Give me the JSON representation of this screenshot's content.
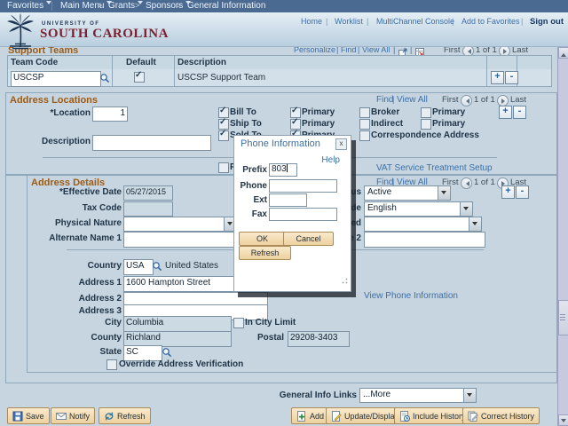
{
  "breadcrumb": {
    "favorites": "Favorites",
    "main_menu": "Main Menu",
    "grants": "Grants",
    "sponsors": "Sponsors",
    "current": "General Information"
  },
  "header": {
    "home": "Home",
    "worklist": "Worklist",
    "multichannel_console": "MultiChannel Console",
    "add_to_favorites": "Add to Favorites",
    "sign_out": "Sign out",
    "university_line1": "UNIVERSITY OF",
    "university_line2": "SOUTH CAROLINA"
  },
  "support_teams": {
    "title": "Support Teams",
    "toolbar": {
      "personalize": "Personalize",
      "find": "Find",
      "view_all": "View All",
      "first": "First",
      "range": "1 of 1",
      "last": "Last"
    },
    "columns": {
      "team_code": "Team Code",
      "default": "Default",
      "description": "Description"
    },
    "row": {
      "team_code": "USCSP",
      "description": "USCSP Support Team",
      "plus": "+",
      "minus": "-"
    }
  },
  "address_locations": {
    "title": "Address Locations",
    "toolbar": {
      "find": "Find",
      "view_all": "View All",
      "first": "First",
      "range": "1 of 1",
      "last": "Last"
    },
    "location_label": "*Location",
    "location_value": "1",
    "description_label": "Description",
    "description_value": "",
    "checkboxes": {
      "bill_to": "Bill To",
      "bill_primary": "Primary",
      "broker": "Broker",
      "broker_primary": "Primary",
      "ship_to": "Ship To",
      "ship_primary": "Primary",
      "indirect": "Indirect",
      "indirect_primary": "Primary",
      "sold_to": "Sold To",
      "sold_primary": "Primary",
      "correspondence": "Correspondence Address",
      "remit_to": "Remit To"
    },
    "vat_link": "VAT Service Treatment Setup",
    "plus": "+",
    "minus": "-"
  },
  "address_details": {
    "title": "Address Details",
    "toolbar": {
      "find": "Find",
      "view_all": "View All",
      "first": "First",
      "range": "1 of 1",
      "last": "Last"
    },
    "effective_date_label": "*Effective Date",
    "effective_date_value": "05/27/2015",
    "tax_code_label": "Tax Code",
    "tax_code_value": "",
    "physical_nature_label": "Physical Nature",
    "physical_nature_value": "",
    "alternate_name1_label": "Alternate Name 1",
    "alternate_name1_value": "",
    "status_label": "Status",
    "status_value": "Active",
    "language_code_label": "Language Code",
    "language_code_value": "English",
    "where_performed_label": "Where Performed",
    "where_performed_value": "",
    "alternate_name2_label": "Alternate Name 2",
    "alternate_name2_value": "",
    "country_label": "Country",
    "country_code": "USA",
    "country_name": "United States",
    "address1_label": "Address 1",
    "address1_value": "1600 Hampton Street",
    "address2_label": "Address 2",
    "address2_value": "",
    "address3_label": "Address 3",
    "address3_value": "",
    "city_label": "City",
    "city_value": "Columbia",
    "in_city_limit_label": "In City Limit",
    "county_label": "County",
    "county_value": "Richland",
    "postal_label": "Postal",
    "postal_value": "29208-3403",
    "state_label": "State",
    "state_value": "SC",
    "override_label": "Override Address Verification",
    "view_phone_link": "View Phone Information",
    "plus": "+",
    "minus": "-"
  },
  "phone_modal": {
    "title": "Phone Information",
    "close": "x",
    "help": "Help",
    "prefix_label": "Prefix",
    "prefix_value": "803",
    "phone_label": "Phone",
    "phone_value": "",
    "ext_label": "Ext",
    "ext_value": "",
    "fax_label": "Fax",
    "fax_value": "",
    "ok": "OK",
    "cancel": "Cancel",
    "refresh": "Refresh"
  },
  "footer": {
    "general_info_label": "General Info Links",
    "general_info_value": "...More"
  },
  "toolbar": {
    "save": "Save",
    "notify": "Notify",
    "refresh": "Refresh",
    "add": "Add",
    "update_display": "Update/Display",
    "include_history": "Include History",
    "correct_history": "Correct History"
  }
}
